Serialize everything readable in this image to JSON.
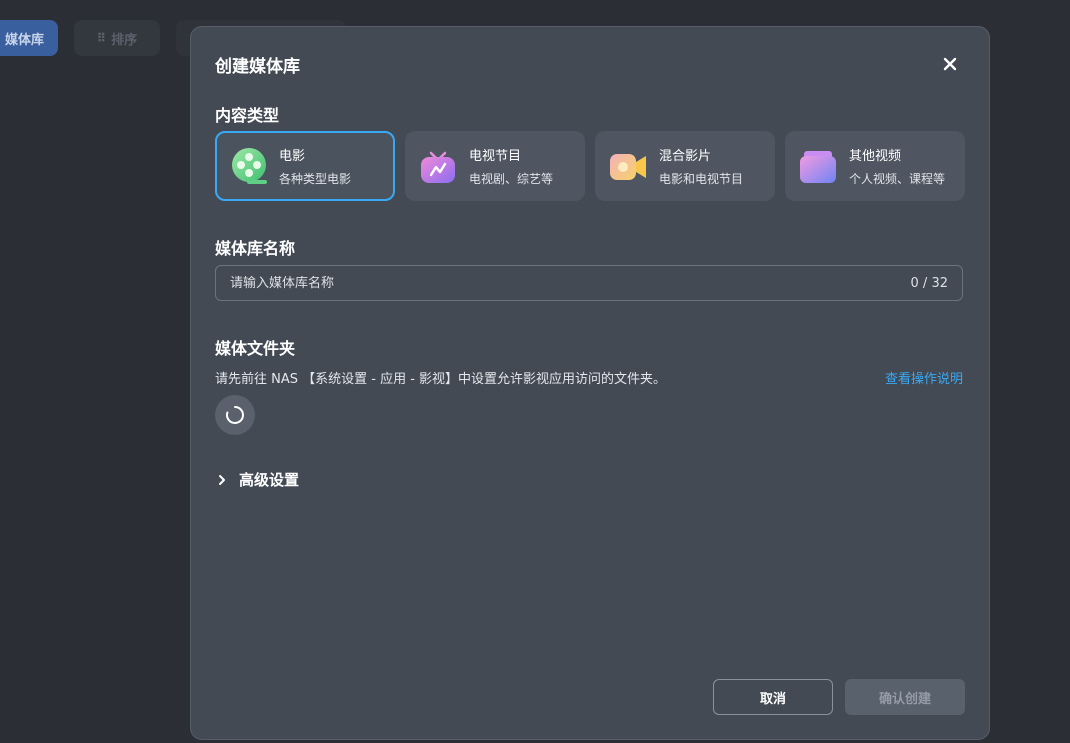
{
  "background": {
    "primary_button_label": "媒体库",
    "sort_button_label": "排序"
  },
  "dialog": {
    "title": "创建媒体库",
    "content_type": {
      "label": "内容类型",
      "selected": "movie",
      "options": [
        {
          "id": "movie",
          "title": "电影",
          "desc": "各种类型电影",
          "icon": "film-reel-icon"
        },
        {
          "id": "tv",
          "title": "电视节目",
          "desc": "电视剧、综艺等",
          "icon": "tv-icon"
        },
        {
          "id": "mixed",
          "title": "混合影片",
          "desc": "电影和电视节目",
          "icon": "video-camera-icon"
        },
        {
          "id": "other",
          "title": "其他视频",
          "desc": "个人视频、课程等",
          "icon": "folder-icon"
        }
      ]
    },
    "library_name": {
      "label": "媒体库名称",
      "value": "",
      "placeholder": "请输入媒体库名称",
      "counter": "0 / 32"
    },
    "media_folder": {
      "label": "媒体文件夹",
      "hint": "请先前往 NAS 【系统设置 - 应用 - 影视】中设置允许影视应用访问的文件夹。",
      "help_link": "查看操作说明"
    },
    "advanced": {
      "label": "高级设置"
    },
    "buttons": {
      "cancel": "取消",
      "confirm": "确认创建"
    }
  },
  "colors": {
    "accent": "#38a9f5",
    "dialog_bg": "#434a54",
    "card_bg": "#4f5661"
  }
}
